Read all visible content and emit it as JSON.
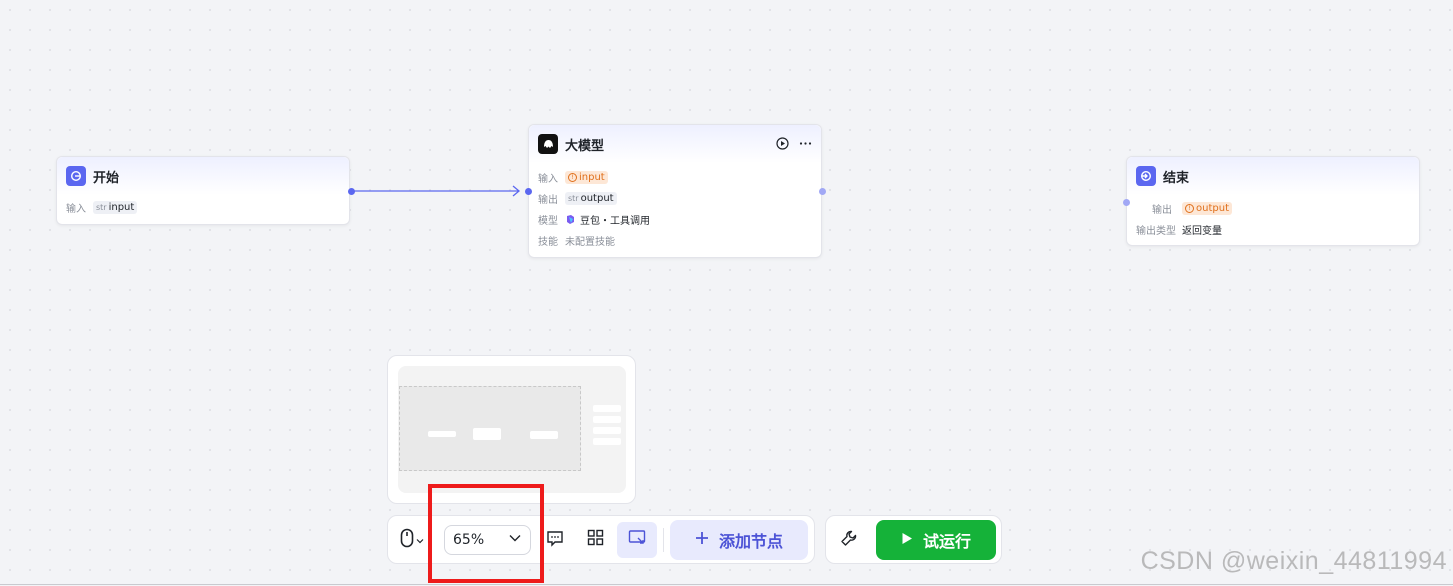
{
  "nodes": {
    "start": {
      "title": "开始",
      "rows": [
        {
          "label": "输入",
          "type": "str",
          "value": "input"
        }
      ]
    },
    "llm": {
      "title": "大模型",
      "rows": {
        "input": {
          "label": "输入",
          "value": "input"
        },
        "output": {
          "label": "输出",
          "type": "str",
          "value": "output"
        },
        "model": {
          "label": "模型",
          "value": "豆包・工具调用"
        },
        "skill": {
          "label": "技能",
          "value": "未配置技能"
        }
      }
    },
    "end": {
      "title": "结束",
      "rows": {
        "output": {
          "label": "输出",
          "value": "output"
        },
        "output_type": {
          "label": "输出类型",
          "value": "返回变量"
        }
      }
    }
  },
  "toolbar": {
    "zoom": "65%",
    "add_node_label": "添加节点",
    "run_label": "试运行"
  },
  "watermark": "CSDN @weixin_44811994",
  "colors": {
    "accent": "#5b67f0",
    "run_green": "#15b239",
    "warning_orange": "#e0701c",
    "highlight_red": "#ee1b1b"
  }
}
